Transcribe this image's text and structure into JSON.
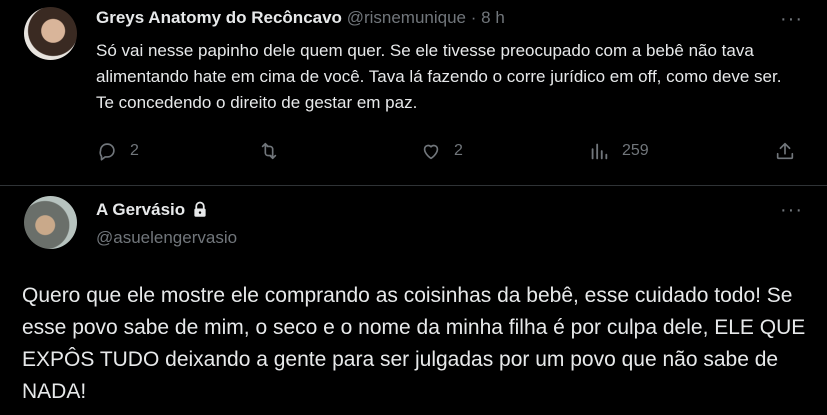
{
  "tweet1": {
    "author_name": "Greys Anatomy do Recôncavo",
    "handle": "@risnemunique",
    "separator": "·",
    "time": "8 h",
    "more_icon": "ellipsis-icon",
    "text": "Só vai nesse papinho dele quem quer. Se ele tivesse preocupado com a bebê não tava alimentando hate em cima de você. Tava lá fazendo o corre jurídico em off, como deve ser. Te concedendo o direito de gestar em paz.",
    "replies": "2",
    "likes": "2",
    "views": "259"
  },
  "tweet2": {
    "author_name": "A Gervásio",
    "handle": "@asuelengervasio",
    "more_icon": "ellipsis-icon",
    "text": "Quero que ele mostre ele comprando as coisinhas da bebê, esse cuidado todo! Se esse povo sabe de mim, o seco e o nome da minha filha é por culpa dele, ELE QUE EXPÔS TUDO deixando a gente para ser julgadas por um povo que não sabe de NADA!"
  },
  "colors": {
    "background": "#000000",
    "text": "#e7e9ea",
    "muted": "#71767b",
    "divider": "#2f3336"
  }
}
